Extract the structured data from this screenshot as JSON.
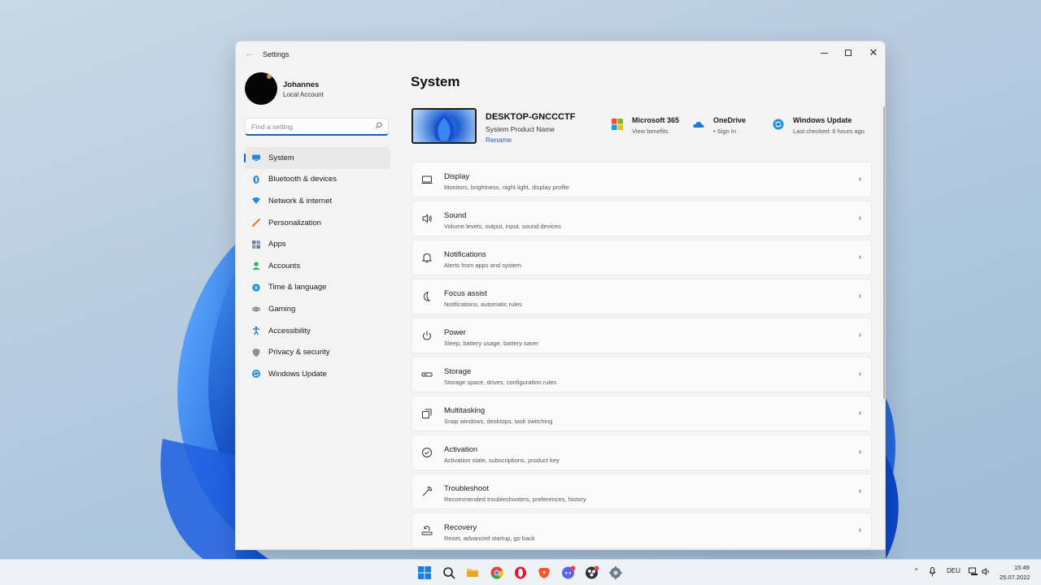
{
  "window": {
    "app_title": "Settings",
    "back_icon": "back-arrow-icon",
    "controls": [
      "minimize-icon",
      "maximize-icon",
      "close-icon"
    ]
  },
  "profile": {
    "name": "Johannes",
    "account_type": "Local Account"
  },
  "search": {
    "placeholder": "Find a setting"
  },
  "nav": {
    "items": [
      {
        "label": "System",
        "icon": "system-icon",
        "active": true
      },
      {
        "label": "Bluetooth & devices",
        "icon": "bluetooth-icon"
      },
      {
        "label": "Network & internet",
        "icon": "wifi-icon"
      },
      {
        "label": "Personalization",
        "icon": "brush-icon"
      },
      {
        "label": "Apps",
        "icon": "apps-icon"
      },
      {
        "label": "Accounts",
        "icon": "accounts-icon"
      },
      {
        "label": "Time & language",
        "icon": "globe-icon"
      },
      {
        "label": "Gaming",
        "icon": "gamepad-icon"
      },
      {
        "label": "Accessibility",
        "icon": "accessibility-icon"
      },
      {
        "label": "Privacy & security",
        "icon": "shield-icon"
      },
      {
        "label": "Windows Update",
        "icon": "update-icon"
      }
    ]
  },
  "main": {
    "title": "System",
    "device": {
      "name": "DESKTOP-GNCCCTF",
      "model": "System Product Name",
      "rename_label": "Rename"
    },
    "quick_links": [
      {
        "title": "Microsoft 365",
        "subtitle": "View benefits",
        "icon": "microsoft-logo-icon"
      },
      {
        "title": "OneDrive",
        "subtitle": "• Sign In",
        "icon": "onedrive-cloud-icon"
      },
      {
        "title": "Windows Update",
        "subtitle": "Last checked: 6 hours ago",
        "icon": "windows-update-icon"
      }
    ],
    "cards": [
      {
        "title": "Display",
        "subtitle": "Monitors, brightness, night light, display profile",
        "icon": "display-icon"
      },
      {
        "title": "Sound",
        "subtitle": "Volume levels, output, input, sound devices",
        "icon": "speaker-icon"
      },
      {
        "title": "Notifications",
        "subtitle": "Alerts from apps and system",
        "icon": "bell-icon"
      },
      {
        "title": "Focus assist",
        "subtitle": "Notifications, automatic rules",
        "icon": "moon-icon"
      },
      {
        "title": "Power",
        "subtitle": "Sleep, battery usage, battery saver",
        "icon": "power-icon"
      },
      {
        "title": "Storage",
        "subtitle": "Storage space, drives, configuration rules",
        "icon": "storage-icon"
      },
      {
        "title": "Multitasking",
        "subtitle": "Snap windows, desktops, task switching",
        "icon": "multitasking-icon"
      },
      {
        "title": "Activation",
        "subtitle": "Activation state, subscriptions, product key",
        "icon": "check-circle-icon"
      },
      {
        "title": "Troubleshoot",
        "subtitle": "Recommended troubleshooters, preferences, history",
        "icon": "wrench-icon"
      },
      {
        "title": "Recovery",
        "subtitle": "Reset, advanced startup, go back",
        "icon": "recovery-icon"
      }
    ]
  },
  "taskbar": {
    "apps": [
      "start-icon",
      "search-icon",
      "file-explorer-icon",
      "chrome-icon",
      "opera-icon",
      "brave-icon",
      "discord-icon",
      "obs-icon",
      "settings-gear-icon"
    ],
    "tray": {
      "language": "DEU",
      "time": "15:49",
      "date": "25.07.2022"
    }
  },
  "colors": {
    "accent": "#1b5fb3",
    "window_bg": "#f3f3f3",
    "card_bg": "#fbfbfb"
  }
}
